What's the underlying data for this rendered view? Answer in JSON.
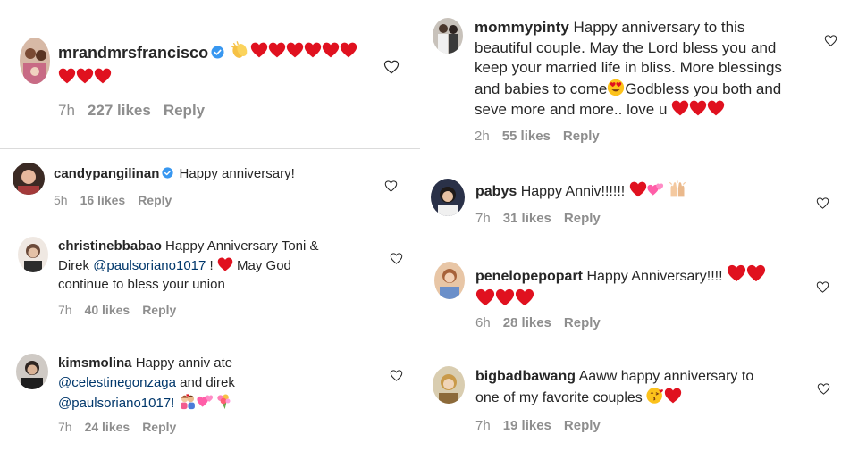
{
  "icons": {
    "like": "heart-outline-icon",
    "verified": "verified-badge-icon",
    "red_heart": "red-heart-emoji"
  },
  "colors": {
    "text": "#262626",
    "meta": "#8e8e8e",
    "mention": "#00376b",
    "verified": "#3897f0",
    "heart": "#e0111f"
  },
  "comments": [
    {
      "user": "mrandmrsfrancisco",
      "verified": true,
      "time": "7h",
      "likes": "227 likes",
      "reply": "Reply"
    },
    {
      "user": "candypangilinan",
      "verified": true,
      "text": "Happy anniversary!",
      "time": "5h",
      "likes": "16 likes",
      "reply": "Reply"
    },
    {
      "user": "christinebbabao",
      "text1": "Happy Anniversary Toni &",
      "text2a": "Direk",
      "mention": "@paulsoriano1017",
      "text2b": "!",
      "text2c": "May God",
      "text3": "continue to bless your union",
      "time": "7h",
      "likes": "40 likes",
      "reply": "Reply"
    },
    {
      "user": "kimsmolina",
      "text1": "Happy anniv ate",
      "mention1": "@celestinegonzaga",
      "text2": " and direk",
      "mention2": "@paulsoriano1017!",
      "time": "7h",
      "likes": "24 likes",
      "reply": "Reply"
    },
    {
      "user": "mommypinty",
      "text1": "Happy anniversary to this",
      "text2": "beautiful couple. May the Lord bless you and",
      "text3": "keep your married life in bliss. More blessings",
      "text4a": "and babies to come",
      "text4b": "Godbless you both and",
      "text5": "seve more and more.. love u",
      "time": "2h",
      "likes": "55 likes",
      "reply": "Reply"
    },
    {
      "user": "pabys",
      "text": "Happy Anniv!!!!!!",
      "time": "7h",
      "likes": "31 likes",
      "reply": "Reply"
    },
    {
      "user": "penelopepopart",
      "text": "Happy Anniversary!!!!",
      "time": "6h",
      "likes": "28 likes",
      "reply": "Reply"
    },
    {
      "user": "bigbadbawang",
      "text1": "Aaww happy anniversary to",
      "text2": "one of my favorite couples",
      "time": "7h",
      "likes": "19 likes",
      "reply": "Reply"
    }
  ]
}
